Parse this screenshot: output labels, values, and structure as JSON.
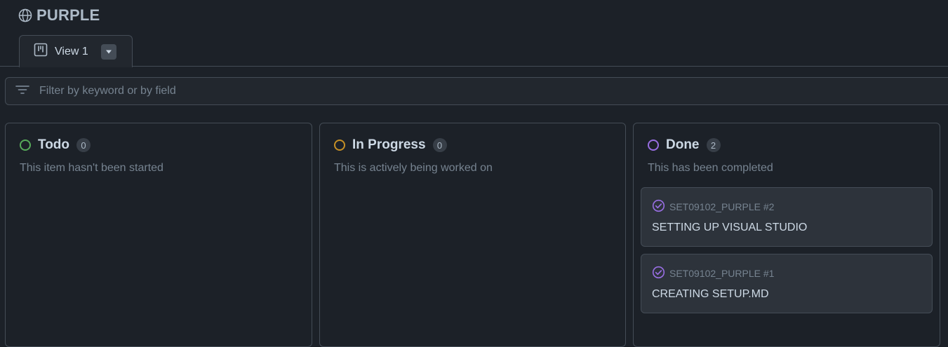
{
  "project": {
    "title": "PURPLE",
    "icon": "globe-icon"
  },
  "views": [
    {
      "label": "View 1",
      "icon": "table-board-icon",
      "menu_icon": "triangle-down-icon"
    }
  ],
  "filter": {
    "placeholder": "Filter by keyword or by field",
    "value": "",
    "icon": "filter-icon"
  },
  "columns": [
    {
      "title": "Todo",
      "count": "0",
      "description": "This item hasn't been started",
      "color": "#57ab5a",
      "cards": []
    },
    {
      "title": "In Progress",
      "count": "0",
      "description": "This is actively being worked on",
      "color": "#c69026",
      "cards": []
    },
    {
      "title": "Done",
      "count": "2",
      "description": "This has been completed",
      "color": "#986ee2",
      "cards": [
        {
          "ref": "SET09102_PURPLE #2",
          "title": "SETTING UP VISUAL STUDIO",
          "icon": "issue-closed-icon"
        },
        {
          "ref": "SET09102_PURPLE #1",
          "title": "CREATING SETUP.MD",
          "icon": "issue-closed-icon"
        }
      ]
    }
  ]
}
